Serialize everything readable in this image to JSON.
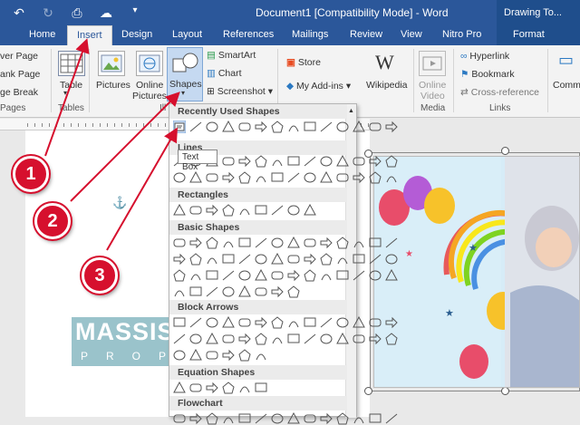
{
  "titlebar": {
    "document_title": "Document1 [Compatibility Mode] - Word",
    "context_group": "Drawing To..."
  },
  "tabs": [
    "Home",
    "Insert",
    "Design",
    "Layout",
    "References",
    "Mailings",
    "Review",
    "View",
    "Nitro Pro",
    "Format"
  ],
  "active_tab": "Insert",
  "ribbon": {
    "pages_items": [
      "ver Page",
      "ank Page",
      "ge Break"
    ],
    "pages_group": "Pages",
    "table_label": "Table",
    "tables_group": "Tables",
    "pictures_label": "Pictures",
    "online_pictures_label": [
      "Online",
      "Pictures"
    ],
    "shapes_label": "Shapes",
    "illustrations_group": "Ill",
    "smartart_label": "SmartArt",
    "chart_label": "Chart",
    "screenshot_label": "Screenshot",
    "store_label": "Store",
    "myaddins_label": "My Add-ins",
    "wikipedia_label": "Wikipedia",
    "online_video_label": [
      "Online",
      "Video"
    ],
    "media_group": "Media",
    "hyperlink_label": "Hyperlink",
    "bookmark_label": "Bookmark",
    "crossref_label": "Cross-reference",
    "links_group": "Links",
    "comment_label": "Comm"
  },
  "shapes_menu": {
    "categories": [
      "Recently Used Shapes",
      "Lines",
      "Rectangles",
      "Basic Shapes",
      "Block Arrows",
      "Equation Shapes",
      "Flowchart"
    ],
    "tooltip": "Text Box"
  },
  "callouts": [
    "1",
    "2",
    "3"
  ],
  "watermark": {
    "top": "MASSISWO",
    "bottom": "PROPERTY"
  },
  "colors": {
    "word_blue": "#2b579a",
    "callout_red": "#d6102e",
    "shapes_highlight": "#c5d9f1"
  }
}
